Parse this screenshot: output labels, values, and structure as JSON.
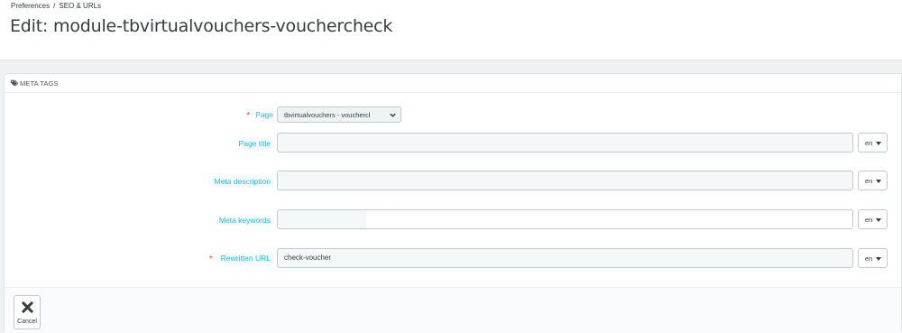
{
  "breadcrumb": {
    "items": [
      "Preferences",
      "SEO & URLs"
    ],
    "separator": "/"
  },
  "page_title": "Edit: module-tbvirtualvouchers-vouchercheck",
  "panel": {
    "heading": "META TAGS",
    "heading_icon": "tags-icon",
    "fields": {
      "page": {
        "label": "Page",
        "required": "*",
        "value": "tbvirtualvouchers - vouchercl"
      },
      "page_title": {
        "label": "Page title",
        "value": "",
        "lang": "en"
      },
      "meta_description": {
        "label": "Meta description",
        "value": "",
        "lang": "en"
      },
      "meta_keywords": {
        "label": "Meta keywords",
        "value": "",
        "lang": "en"
      },
      "rewritten_url": {
        "label": "Rewritten URL",
        "required": "*",
        "value": "check-voucher",
        "lang": "en"
      }
    }
  },
  "footer": {
    "cancel_label": "Cancel",
    "cancel_icon": "close-icon"
  },
  "colors": {
    "label": "#25b9d7",
    "required": "#e84e1b",
    "border": "#bbcdd2",
    "background": "#eff1f2"
  }
}
